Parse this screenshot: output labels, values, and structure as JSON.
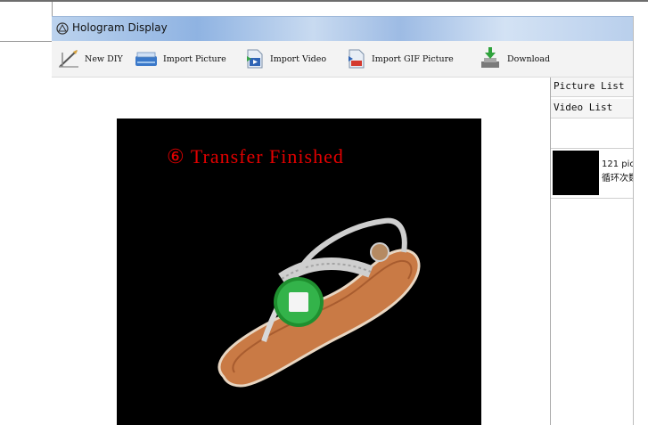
{
  "window": {
    "title": "Hologram Display"
  },
  "toolbar": {
    "items": [
      {
        "label": "New DIY",
        "icon": "pencil-ruler-icon"
      },
      {
        "label": "Import Picture",
        "icon": "scanner-icon"
      },
      {
        "label": "Import Video",
        "icon": "video-import-icon"
      },
      {
        "label": "Import GIF Picture",
        "icon": "gif-import-icon"
      },
      {
        "label": "Download",
        "icon": "download-icon"
      }
    ]
  },
  "preview": {
    "status": "⑥ Transfer Finished",
    "status_color": "#e10000",
    "play_button_icon": "stop-icon"
  },
  "sidepanel": {
    "tabs": [
      {
        "label": "Picture List"
      },
      {
        "label": "Video List"
      }
    ],
    "video_items": [
      {
        "line1": "121 pic",
        "line2": "循环次数"
      }
    ]
  }
}
